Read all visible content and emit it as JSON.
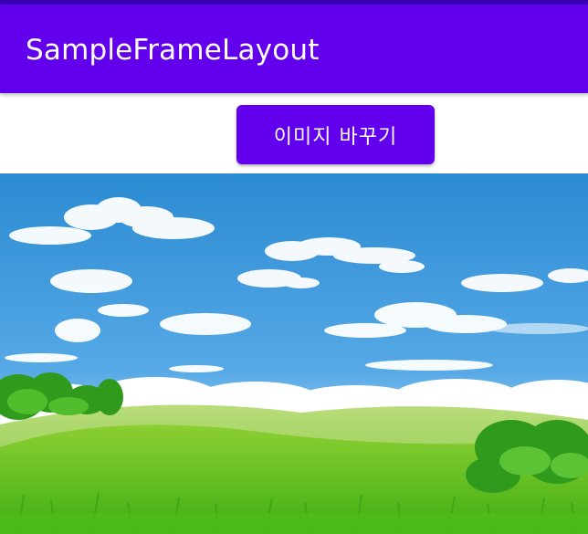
{
  "app_bar": {
    "title": "SampleFrameLayout",
    "color": "#6200ee",
    "status_bar_color": "#3700b3"
  },
  "main": {
    "button": {
      "label": "이미지 바꾸기",
      "color": "#6200ee"
    },
    "image": {
      "sky_color": "#2a8fd6",
      "grass_color": "#5cc61d"
    }
  }
}
